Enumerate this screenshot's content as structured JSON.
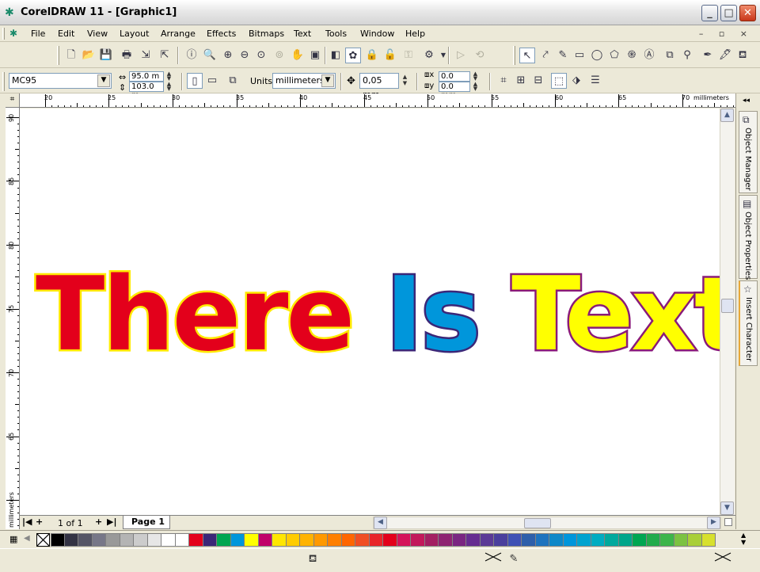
{
  "window": {
    "title": "CorelDRAW 11 - [Graphic1]",
    "buttons": {
      "minimize": "_",
      "maximize": "□",
      "close": "✕"
    }
  },
  "menu": {
    "items": [
      {
        "label": "File"
      },
      {
        "label": "Edit"
      },
      {
        "label": "View"
      },
      {
        "label": "Layout"
      },
      {
        "label": "Arrange"
      },
      {
        "label": "Effects"
      },
      {
        "label": "Bitmaps"
      },
      {
        "label": "Text"
      },
      {
        "label": "Tools"
      },
      {
        "label": "Window"
      },
      {
        "label": "Help"
      }
    ],
    "mdi": "– ▫ ×"
  },
  "property_bar": {
    "paper_type": "MC95",
    "width": "95.0 m",
    "height": "103.0 m",
    "units_label": "Units:",
    "units_value": "millimeters",
    "nudge": "0,05 mm",
    "dup_x": "0.0 mm",
    "dup_y": "0.0 mm"
  },
  "ruler": {
    "top_ticks": [
      "20",
      "25",
      "30",
      "35",
      "40",
      "45",
      "50",
      "55",
      "60",
      "65",
      "70"
    ],
    "top_unit": "millimeters",
    "left_ticks": [
      "90",
      "85",
      "80",
      "75",
      "70",
      "65"
    ],
    "left_unit": "millimeters"
  },
  "canvas": {
    "words": [
      "There",
      "Is",
      "Text"
    ],
    "colors": {
      "word1_fill": "#e3001b",
      "word1_outline": "#ffea00",
      "word2_fill": "#0096db",
      "word2_outline": "#3b2778",
      "word3_fill": "#ffff00",
      "word3_outline": "#8a1a7a"
    }
  },
  "dockers": [
    {
      "label": "Object Manager",
      "icon": "object-manager-icon"
    },
    {
      "label": "Object Properties",
      "icon": "object-properties-icon"
    },
    {
      "label": "Insert Character",
      "icon": "star-icon"
    }
  ],
  "page_nav": {
    "count": "1 of 1",
    "tab": "Page 1"
  },
  "palette": {
    "colors": [
      "#000000",
      "#333344",
      "#555566",
      "#777788",
      "#999999",
      "#b4b4b4",
      "#cccccc",
      "#e6e6e6",
      "#ffffff",
      "#ffffff",
      "#e3001b",
      "#3b2778",
      "#00a651",
      "#0096db",
      "#ffff00",
      "#c0006a",
      "#ffe600",
      "#ffcc00",
      "#ffb300",
      "#ff9900",
      "#ff7f00",
      "#ff6600",
      "#f04e23",
      "#e8262a",
      "#e3001b",
      "#d4145a",
      "#c2185b",
      "#a31f63",
      "#8e2472",
      "#7a2682",
      "#662d91",
      "#5b3a96",
      "#4a3f9d",
      "#3f51b5",
      "#2e5faa",
      "#1e73be",
      "#0e88c8",
      "#0096db",
      "#00a3cf",
      "#00acc1",
      "#00a99d",
      "#00a68a",
      "#00a651",
      "#22ab4c",
      "#3db54a",
      "#7cc242",
      "#a9cf38",
      "#d7e02d"
    ]
  }
}
